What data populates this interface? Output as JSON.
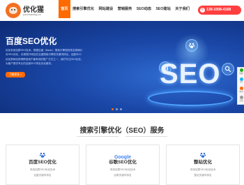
{
  "brand": {
    "name": "优化猩",
    "subtitle": "youhuaxing.cn",
    "color": "#f37021"
  },
  "nav": {
    "items": [
      {
        "label": "首页",
        "active": true
      },
      {
        "label": "搜索引擎优化",
        "active": false
      },
      {
        "label": "网站建设",
        "active": false
      },
      {
        "label": "营销服务",
        "active": false
      },
      {
        "label": "SEO动态",
        "active": false
      },
      {
        "label": "SEO建站",
        "active": false
      },
      {
        "label": "关于我们",
        "active": false
      }
    ],
    "active_color": "#ff6a00"
  },
  "phone": {
    "number": "139-1008-4168",
    "color": "#ff3f3f",
    "icon": "phone-icon"
  },
  "hero": {
    "title": "百度SEO优化",
    "description": "优化采用站群SEO技术，根据百度（Baidu）搜索引擎规则排名规律针对SEO优化，实现提升网站在百度搜索引擎的关键词排名，百度SEO优化是网站获得精准用户最有效的推广方式之一，我们专注SEO优化，为客户提供专业的百度SEO排名优化服务。",
    "button_label": "了解更多 >",
    "graphic_text": "SEO",
    "slides": 3,
    "active_slide": 1
  },
  "side": {
    "items": [
      {
        "label": "客服",
        "icon": "chat-icon"
      },
      {
        "label": "QQ",
        "icon": "qq-icon"
      },
      {
        "label": "电话",
        "icon": "phone-icon"
      },
      {
        "label": "顶部",
        "icon": "arrow-up-icon"
      }
    ]
  },
  "services": {
    "title": "搜索引擎优化（SEO）服务",
    "cards": [
      {
        "title": "百度SEO优化",
        "icon": "baidu-paw-icon",
        "line1": "采用站群SEO优化技术",
        "line2": "百度关键词排名"
      },
      {
        "title": "谷歌SEO优化",
        "icon": "google-logo",
        "logo_text": "Google",
        "line1": "采用站群SEO优化技术",
        "line2": "谷歌关键词排名"
      },
      {
        "title": "整站优化",
        "icon": "site-paw-icon",
        "line1": "采用站群SEO优化技术",
        "line2": "整站关键词排名"
      }
    ]
  }
}
